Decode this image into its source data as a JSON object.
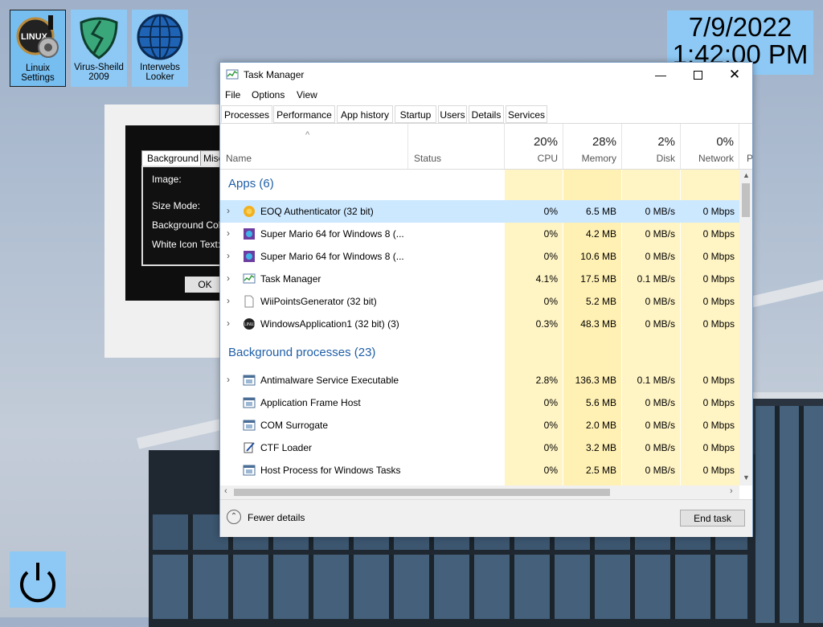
{
  "desktop": {
    "icons": [
      {
        "label": "Linuix Settings"
      },
      {
        "label": "Virus-Sheild 2009"
      },
      {
        "label": "Interwebs Looker"
      }
    ],
    "clock": {
      "date": "7/9/2022",
      "time": "1:42:00 PM"
    }
  },
  "settings_window": {
    "tabs": [
      "Background",
      "Misc"
    ],
    "labels": [
      "Image:",
      "Size Mode:",
      "Background Colour",
      "White Icon Text:"
    ],
    "ok_label": "OK"
  },
  "task_manager": {
    "title": "Task Manager",
    "menu": [
      "File",
      "Options",
      "View"
    ],
    "tabs": [
      "Processes",
      "Performance",
      "App history",
      "Startup",
      "Users",
      "Details",
      "Services"
    ],
    "active_tab": "Processes",
    "columns": {
      "name": "Name",
      "status": "Status",
      "cpu": {
        "pct": "20%",
        "label": "CPU"
      },
      "memory": {
        "pct": "28%",
        "label": "Memory"
      },
      "disk": {
        "pct": "2%",
        "label": "Disk"
      },
      "network": {
        "pct": "0%",
        "label": "Network"
      },
      "power": {
        "label": "P"
      }
    },
    "groups": [
      {
        "title": "Apps (6)",
        "rows": [
          {
            "name": "EOQ Authenticator (32 bit)",
            "cpu": "0%",
            "memory": "6.5 MB",
            "disk": "0 MB/s",
            "network": "0 Mbps",
            "expandable": true,
            "selected": true,
            "icon": "shield-badge-icon"
          },
          {
            "name": "Super Mario 64 for Windows 8 (...",
            "cpu": "0%",
            "memory": "4.2 MB",
            "disk": "0 MB/s",
            "network": "0 Mbps",
            "expandable": true,
            "icon": "game-icon"
          },
          {
            "name": "Super Mario 64 for Windows 8 (...",
            "cpu": "0%",
            "memory": "10.6 MB",
            "disk": "0 MB/s",
            "network": "0 Mbps",
            "expandable": true,
            "icon": "game-icon"
          },
          {
            "name": "Task Manager",
            "cpu": "4.1%",
            "memory": "17.5 MB",
            "disk": "0.1 MB/s",
            "network": "0 Mbps",
            "expandable": true,
            "icon": "task-manager-icon"
          },
          {
            "name": "WiiPointsGenerator (32 bit)",
            "cpu": "0%",
            "memory": "5.2 MB",
            "disk": "0 MB/s",
            "network": "0 Mbps",
            "expandable": true,
            "icon": "document-icon"
          },
          {
            "name": "WindowsApplication1 (32 bit) (3)",
            "cpu": "0.3%",
            "memory": "48.3 MB",
            "disk": "0 MB/s",
            "network": "0 Mbps",
            "expandable": true,
            "icon": "linux-badge-icon"
          }
        ]
      },
      {
        "title": "Background processes (23)",
        "rows": [
          {
            "name": "Antimalware Service Executable",
            "cpu": "2.8%",
            "memory": "136.3 MB",
            "disk": "0.1 MB/s",
            "network": "0 Mbps",
            "expandable": true,
            "icon": "window-icon"
          },
          {
            "name": "Application Frame Host",
            "cpu": "0%",
            "memory": "5.6 MB",
            "disk": "0 MB/s",
            "network": "0 Mbps",
            "expandable": false,
            "icon": "window-icon"
          },
          {
            "name": "COM Surrogate",
            "cpu": "0%",
            "memory": "2.0 MB",
            "disk": "0 MB/s",
            "network": "0 Mbps",
            "expandable": false,
            "icon": "window-icon"
          },
          {
            "name": "CTF Loader",
            "cpu": "0%",
            "memory": "3.2 MB",
            "disk": "0 MB/s",
            "network": "0 Mbps",
            "expandable": false,
            "icon": "pen-icon"
          },
          {
            "name": "Host Process for Windows Tasks",
            "cpu": "0%",
            "memory": "2.5 MB",
            "disk": "0 MB/s",
            "network": "0 Mbps",
            "expandable": false,
            "icon": "window-icon"
          }
        ]
      }
    ],
    "footer": {
      "fewer_details": "Fewer details",
      "end_task": "End task"
    }
  }
}
